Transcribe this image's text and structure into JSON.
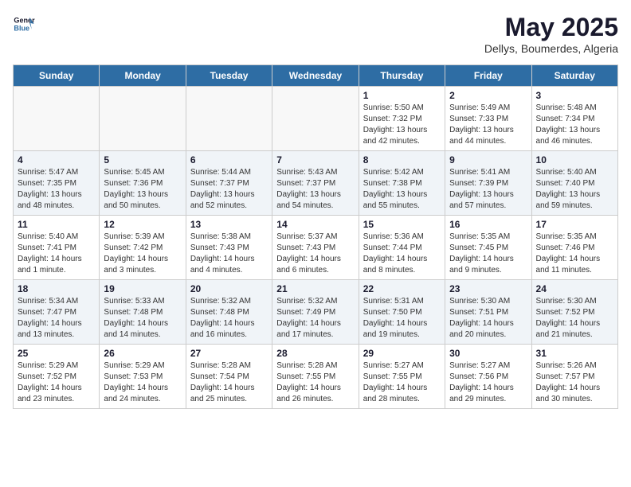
{
  "header": {
    "logo_line1": "General",
    "logo_line2": "Blue",
    "month": "May 2025",
    "location": "Dellys, Boumerdes, Algeria"
  },
  "days_of_week": [
    "Sunday",
    "Monday",
    "Tuesday",
    "Wednesday",
    "Thursday",
    "Friday",
    "Saturday"
  ],
  "weeks": [
    [
      {
        "day": "",
        "info": ""
      },
      {
        "day": "",
        "info": ""
      },
      {
        "day": "",
        "info": ""
      },
      {
        "day": "",
        "info": ""
      },
      {
        "day": "1",
        "info": "Sunrise: 5:50 AM\nSunset: 7:32 PM\nDaylight: 13 hours\nand 42 minutes."
      },
      {
        "day": "2",
        "info": "Sunrise: 5:49 AM\nSunset: 7:33 PM\nDaylight: 13 hours\nand 44 minutes."
      },
      {
        "day": "3",
        "info": "Sunrise: 5:48 AM\nSunset: 7:34 PM\nDaylight: 13 hours\nand 46 minutes."
      }
    ],
    [
      {
        "day": "4",
        "info": "Sunrise: 5:47 AM\nSunset: 7:35 PM\nDaylight: 13 hours\nand 48 minutes."
      },
      {
        "day": "5",
        "info": "Sunrise: 5:45 AM\nSunset: 7:36 PM\nDaylight: 13 hours\nand 50 minutes."
      },
      {
        "day": "6",
        "info": "Sunrise: 5:44 AM\nSunset: 7:37 PM\nDaylight: 13 hours\nand 52 minutes."
      },
      {
        "day": "7",
        "info": "Sunrise: 5:43 AM\nSunset: 7:37 PM\nDaylight: 13 hours\nand 54 minutes."
      },
      {
        "day": "8",
        "info": "Sunrise: 5:42 AM\nSunset: 7:38 PM\nDaylight: 13 hours\nand 55 minutes."
      },
      {
        "day": "9",
        "info": "Sunrise: 5:41 AM\nSunset: 7:39 PM\nDaylight: 13 hours\nand 57 minutes."
      },
      {
        "day": "10",
        "info": "Sunrise: 5:40 AM\nSunset: 7:40 PM\nDaylight: 13 hours\nand 59 minutes."
      }
    ],
    [
      {
        "day": "11",
        "info": "Sunrise: 5:40 AM\nSunset: 7:41 PM\nDaylight: 14 hours\nand 1 minute."
      },
      {
        "day": "12",
        "info": "Sunrise: 5:39 AM\nSunset: 7:42 PM\nDaylight: 14 hours\nand 3 minutes."
      },
      {
        "day": "13",
        "info": "Sunrise: 5:38 AM\nSunset: 7:43 PM\nDaylight: 14 hours\nand 4 minutes."
      },
      {
        "day": "14",
        "info": "Sunrise: 5:37 AM\nSunset: 7:43 PM\nDaylight: 14 hours\nand 6 minutes."
      },
      {
        "day": "15",
        "info": "Sunrise: 5:36 AM\nSunset: 7:44 PM\nDaylight: 14 hours\nand 8 minutes."
      },
      {
        "day": "16",
        "info": "Sunrise: 5:35 AM\nSunset: 7:45 PM\nDaylight: 14 hours\nand 9 minutes."
      },
      {
        "day": "17",
        "info": "Sunrise: 5:35 AM\nSunset: 7:46 PM\nDaylight: 14 hours\nand 11 minutes."
      }
    ],
    [
      {
        "day": "18",
        "info": "Sunrise: 5:34 AM\nSunset: 7:47 PM\nDaylight: 14 hours\nand 13 minutes."
      },
      {
        "day": "19",
        "info": "Sunrise: 5:33 AM\nSunset: 7:48 PM\nDaylight: 14 hours\nand 14 minutes."
      },
      {
        "day": "20",
        "info": "Sunrise: 5:32 AM\nSunset: 7:48 PM\nDaylight: 14 hours\nand 16 minutes."
      },
      {
        "day": "21",
        "info": "Sunrise: 5:32 AM\nSunset: 7:49 PM\nDaylight: 14 hours\nand 17 minutes."
      },
      {
        "day": "22",
        "info": "Sunrise: 5:31 AM\nSunset: 7:50 PM\nDaylight: 14 hours\nand 19 minutes."
      },
      {
        "day": "23",
        "info": "Sunrise: 5:30 AM\nSunset: 7:51 PM\nDaylight: 14 hours\nand 20 minutes."
      },
      {
        "day": "24",
        "info": "Sunrise: 5:30 AM\nSunset: 7:52 PM\nDaylight: 14 hours\nand 21 minutes."
      }
    ],
    [
      {
        "day": "25",
        "info": "Sunrise: 5:29 AM\nSunset: 7:52 PM\nDaylight: 14 hours\nand 23 minutes."
      },
      {
        "day": "26",
        "info": "Sunrise: 5:29 AM\nSunset: 7:53 PM\nDaylight: 14 hours\nand 24 minutes."
      },
      {
        "day": "27",
        "info": "Sunrise: 5:28 AM\nSunset: 7:54 PM\nDaylight: 14 hours\nand 25 minutes."
      },
      {
        "day": "28",
        "info": "Sunrise: 5:28 AM\nSunset: 7:55 PM\nDaylight: 14 hours\nand 26 minutes."
      },
      {
        "day": "29",
        "info": "Sunrise: 5:27 AM\nSunset: 7:55 PM\nDaylight: 14 hours\nand 28 minutes."
      },
      {
        "day": "30",
        "info": "Sunrise: 5:27 AM\nSunset: 7:56 PM\nDaylight: 14 hours\nand 29 minutes."
      },
      {
        "day": "31",
        "info": "Sunrise: 5:26 AM\nSunset: 7:57 PM\nDaylight: 14 hours\nand 30 minutes."
      }
    ]
  ]
}
